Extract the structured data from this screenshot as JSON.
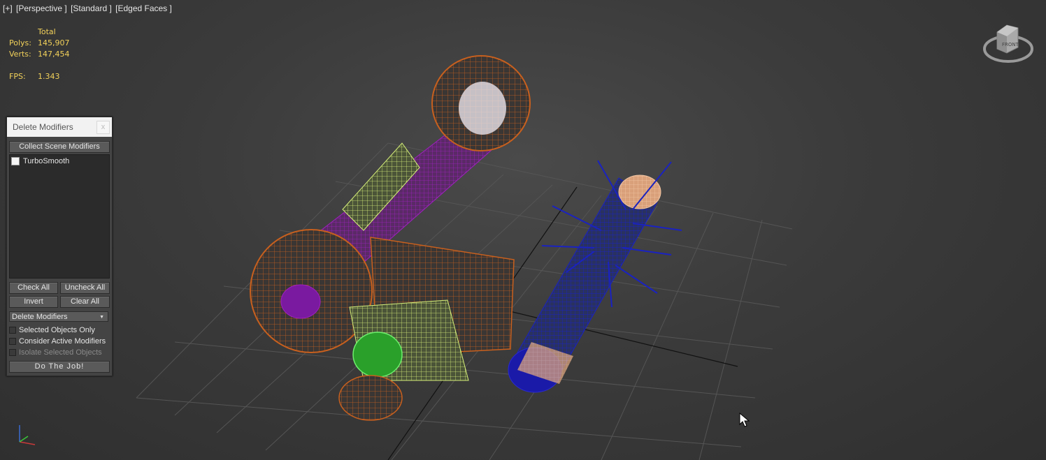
{
  "viewport": {
    "labels": [
      "[+]",
      "[Perspective ]",
      "[Standard ]",
      "[Edged Faces ]"
    ],
    "stats": {
      "header": "Total",
      "polys_label": "Polys:",
      "polys_value": "145,907",
      "verts_label": "Verts:",
      "verts_value": "147,454",
      "fps_label": "FPS:",
      "fps_value": "1.343"
    },
    "viewcube_label": "FRONT"
  },
  "panel": {
    "title": "Delete Modifiers",
    "close_label": "x",
    "collect_button": "Collect Scene Modifiers",
    "list_items": [
      {
        "label": "TurboSmooth",
        "checked": false
      }
    ],
    "check_all": "Check All",
    "uncheck_all": "Uncheck All",
    "invert": "Invert",
    "clear_all": "Clear All",
    "dropdown_value": "Delete Modifiers",
    "options": [
      {
        "label": "Selected Objects Only",
        "checked": false,
        "enabled": true
      },
      {
        "label": "Consider Active Modifiers",
        "checked": false,
        "enabled": true
      },
      {
        "label": "Isolate Selected Objects",
        "checked": false,
        "enabled": false
      }
    ],
    "run_button": "Do The Job!"
  },
  "colors": {
    "stats_text": "#f2d15a",
    "wire_orange": "#c8601e",
    "wire_purple": "#9a20b0",
    "wire_blue": "#1a1ab0",
    "wire_lime": "#d7f07a"
  }
}
